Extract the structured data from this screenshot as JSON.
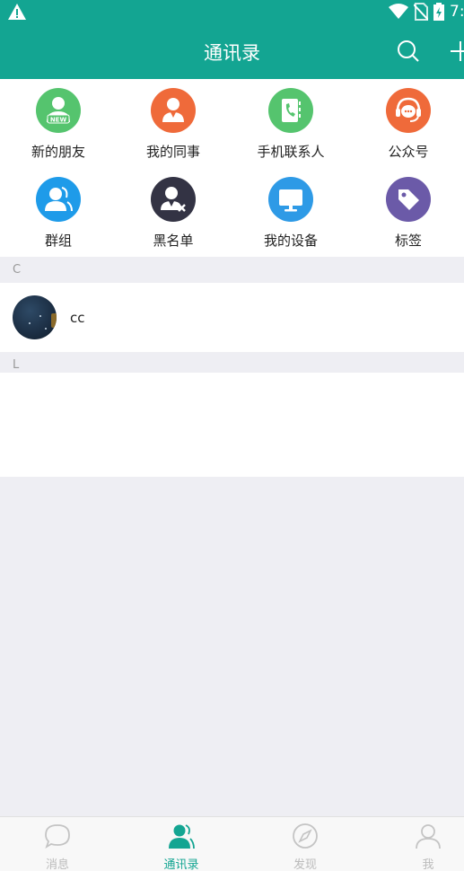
{
  "header": {
    "title": "通讯录",
    "status_time": "7:"
  },
  "colors": {
    "brand": "#13a592",
    "new_friends": "#55c46e",
    "colleagues": "#ef6a3a",
    "phone_contacts": "#55c46e",
    "official_accounts": "#ef6a3a",
    "groups": "#1e9be9",
    "blacklist": "#333344",
    "devices": "#2e9ae6",
    "tags": "#6b5aa8"
  },
  "shortcuts": [
    {
      "label": "新的朋友",
      "icon": "new-friend-icon"
    },
    {
      "label": "我的同事",
      "icon": "colleague-icon"
    },
    {
      "label": "手机联系人",
      "icon": "phone-contacts-icon"
    },
    {
      "label": "公众号",
      "icon": "official-account-icon"
    },
    {
      "label": "群组",
      "icon": "group-icon"
    },
    {
      "label": "黑名单",
      "icon": "blacklist-icon"
    },
    {
      "label": "我的设备",
      "icon": "device-icon"
    },
    {
      "label": "标签",
      "icon": "tag-icon"
    }
  ],
  "sections": [
    {
      "letter": "C",
      "contacts": [
        {
          "name": "cc"
        }
      ]
    },
    {
      "letter": "L",
      "contacts": []
    }
  ],
  "tabs": [
    {
      "label": "消息",
      "icon": "message-icon",
      "active": false
    },
    {
      "label": "通讯录",
      "icon": "contacts-icon",
      "active": true
    },
    {
      "label": "发现",
      "icon": "compass-icon",
      "active": false
    },
    {
      "label": "我",
      "icon": "profile-icon",
      "active": false
    }
  ]
}
